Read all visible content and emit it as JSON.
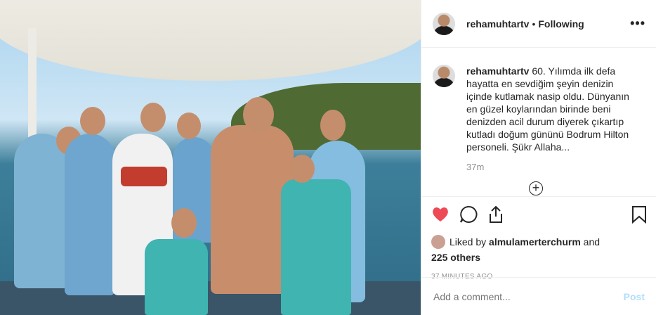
{
  "post": {
    "username": "rehamuhtartv",
    "separator": "•",
    "follow_status": "Following",
    "more": "•••",
    "caption": "60. Yılımda ilk defa hayatta en sevdiğim şeyin denizin içinde kutlamak nasip oldu. Dünyanın en güzel koylarından birinde beni denizden acil durum diyerek çıkartıp kutladı doğum gününü Bodrum Hilton personeli. Şükr Allaha...",
    "time": "37m",
    "liked_by_prefix": "Liked by",
    "liked_by_user": "almulamerterchurm",
    "liked_by_suffix": "and",
    "others": "225 others",
    "posted_ago": "37 MINUTES AGO"
  },
  "comment": {
    "placeholder": "Add a comment...",
    "post_label": "Post"
  },
  "icons": {
    "like": "heart-icon",
    "comment": "comment-icon",
    "share": "share-icon",
    "save": "bookmark-icon",
    "load_more": "plus-circle-icon"
  },
  "colors": {
    "like": "#ed4956",
    "post_disabled": "#b2dffc",
    "meta": "#8e8e8e"
  }
}
